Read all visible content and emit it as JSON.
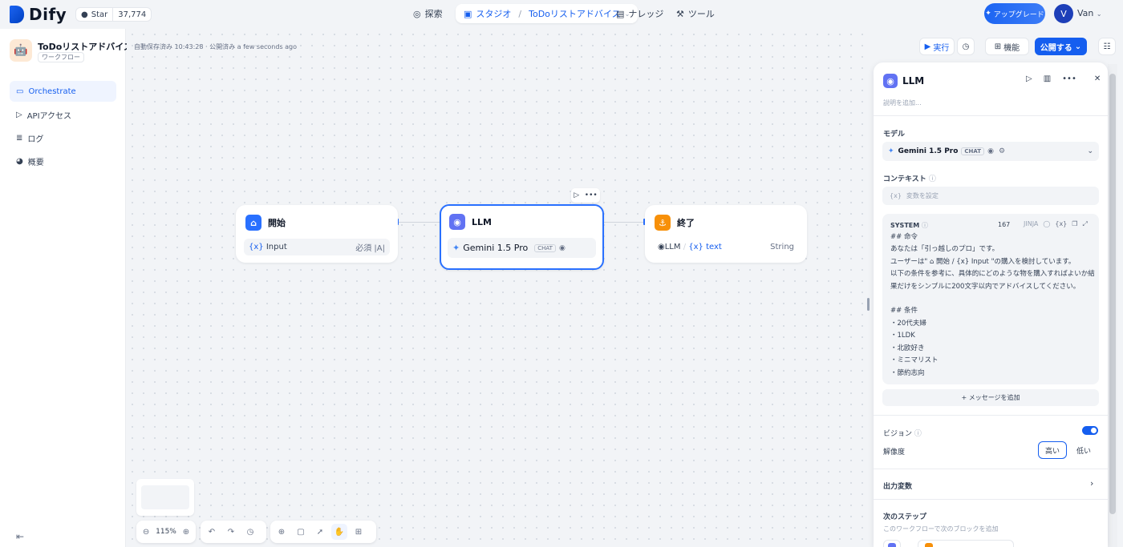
{
  "topbar": {
    "brand": "Dify",
    "github": {
      "star_label": "Star",
      "count": "37,774"
    },
    "nav": {
      "explore": "探索",
      "studio": "スタジオ",
      "studio_app": "ToDoリストアドバイス",
      "knowledge": "ナレッジ",
      "tools": "ツール"
    },
    "upgrade": "アップグレード",
    "user": {
      "initial": "V",
      "name": "Van"
    }
  },
  "sidebar": {
    "app_name": "ToDoリストアドバイス",
    "app_type": "ワークフロー",
    "items": [
      {
        "label": "Orchestrate"
      },
      {
        "label": "APIアクセス"
      },
      {
        "label": "ログ"
      },
      {
        "label": "概要"
      }
    ]
  },
  "canvas": {
    "autosave": "自動保存済み 10:43:28 · 公開済み a few seconds ago",
    "run_label": "実行",
    "features_label": "機能",
    "publish_label": "公開する",
    "zoom": "115%",
    "nodes": {
      "start": {
        "title": "開始",
        "var_name": "Input",
        "var_required": "必須"
      },
      "llm": {
        "title": "LLM",
        "model": "Gemini 1.5 Pro",
        "mode": "CHAT"
      },
      "end": {
        "title": "終了",
        "src_node": "LLM",
        "var_name": "text",
        "var_type": "String"
      }
    }
  },
  "panel": {
    "title": "LLM",
    "description_placeholder": "説明を追加...",
    "model_label": "モデル",
    "model_name": "Gemini 1.5 Pro",
    "model_mode": "CHAT",
    "context_label": "コンテキスト",
    "context_placeholder": "変数を設定",
    "system": {
      "label": "SYSTEM",
      "count": "167",
      "jinja": "JINJA",
      "lines": [
        "## 命令",
        "あなたは「引っ越しのプロ」です。",
        "ユーザーは\" ⌂ 開始 / {x} Input \"の購入を検討しています。",
        "以下の条件を参考に、具体的にどのような物を購入すればよいか結",
        "果だけをシンプルに200文字以内でアドバイスしてください。",
        "",
        "## 条件",
        "・20代夫婦",
        "・1LDK",
        "・北欧好き",
        "・ミニマリスト",
        "・節約志向"
      ]
    },
    "add_message": "+ メッセージを追加",
    "vision_label": "ビジョン",
    "resolution_label": "解像度",
    "resolution_high": "高い",
    "resolution_low": "低い",
    "output_vars_label": "出力変数",
    "next_step_label": "次のステップ",
    "next_step_desc": "このワークフローで次のブロックを追加"
  },
  "colors": {
    "accent": "#155eef",
    "start_icon": "#2970ff",
    "llm_icon": "#6172f3",
    "end_icon": "#f79009"
  }
}
